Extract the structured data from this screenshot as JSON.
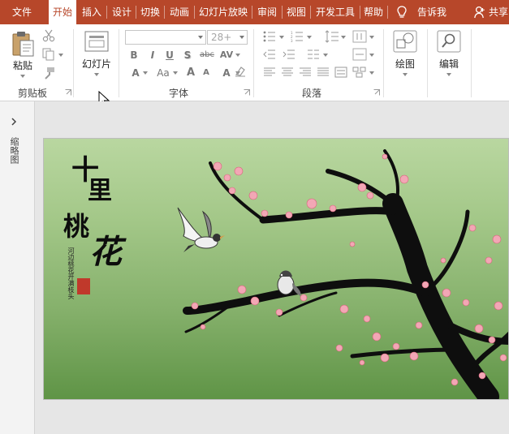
{
  "tabs": [
    {
      "label": "文件",
      "active": false
    },
    {
      "label": "开始",
      "active": true
    },
    {
      "label": "插入",
      "active": false
    },
    {
      "label": "设计",
      "active": false
    },
    {
      "label": "切换",
      "active": false
    },
    {
      "label": "动画",
      "active": false
    },
    {
      "label": "幻灯片放映",
      "active": false
    },
    {
      "label": "审阅",
      "active": false
    },
    {
      "label": "视图",
      "active": false
    },
    {
      "label": "开发工具",
      "active": false
    },
    {
      "label": "帮助",
      "active": false
    }
  ],
  "tell_me": "告诉我",
  "share": "共享",
  "ribbon": {
    "clipboard": {
      "paste": "粘贴",
      "group": "剪贴板"
    },
    "slides": {
      "new_slide": "幻灯片"
    },
    "font": {
      "font_name": "",
      "font_size": "28+",
      "group": "字体",
      "bold": "B",
      "italic": "I",
      "underline": "U",
      "shadow": "S",
      "strike": "abc",
      "spacing": "AV",
      "case": "Aa"
    },
    "paragraph": {
      "group": "段落"
    },
    "drawing": {
      "label": "绘图"
    },
    "editing": {
      "label": "编辑"
    }
  },
  "thumbnail_pane": {
    "label": "缩略图"
  },
  "slide": {
    "title_chars": [
      "十",
      "里",
      "桃",
      "花"
    ],
    "poem": "河边桃花开满枝头"
  },
  "colors": {
    "accent": "#b7472a",
    "blossom": "#f2a7b5",
    "branch": "#111111"
  }
}
